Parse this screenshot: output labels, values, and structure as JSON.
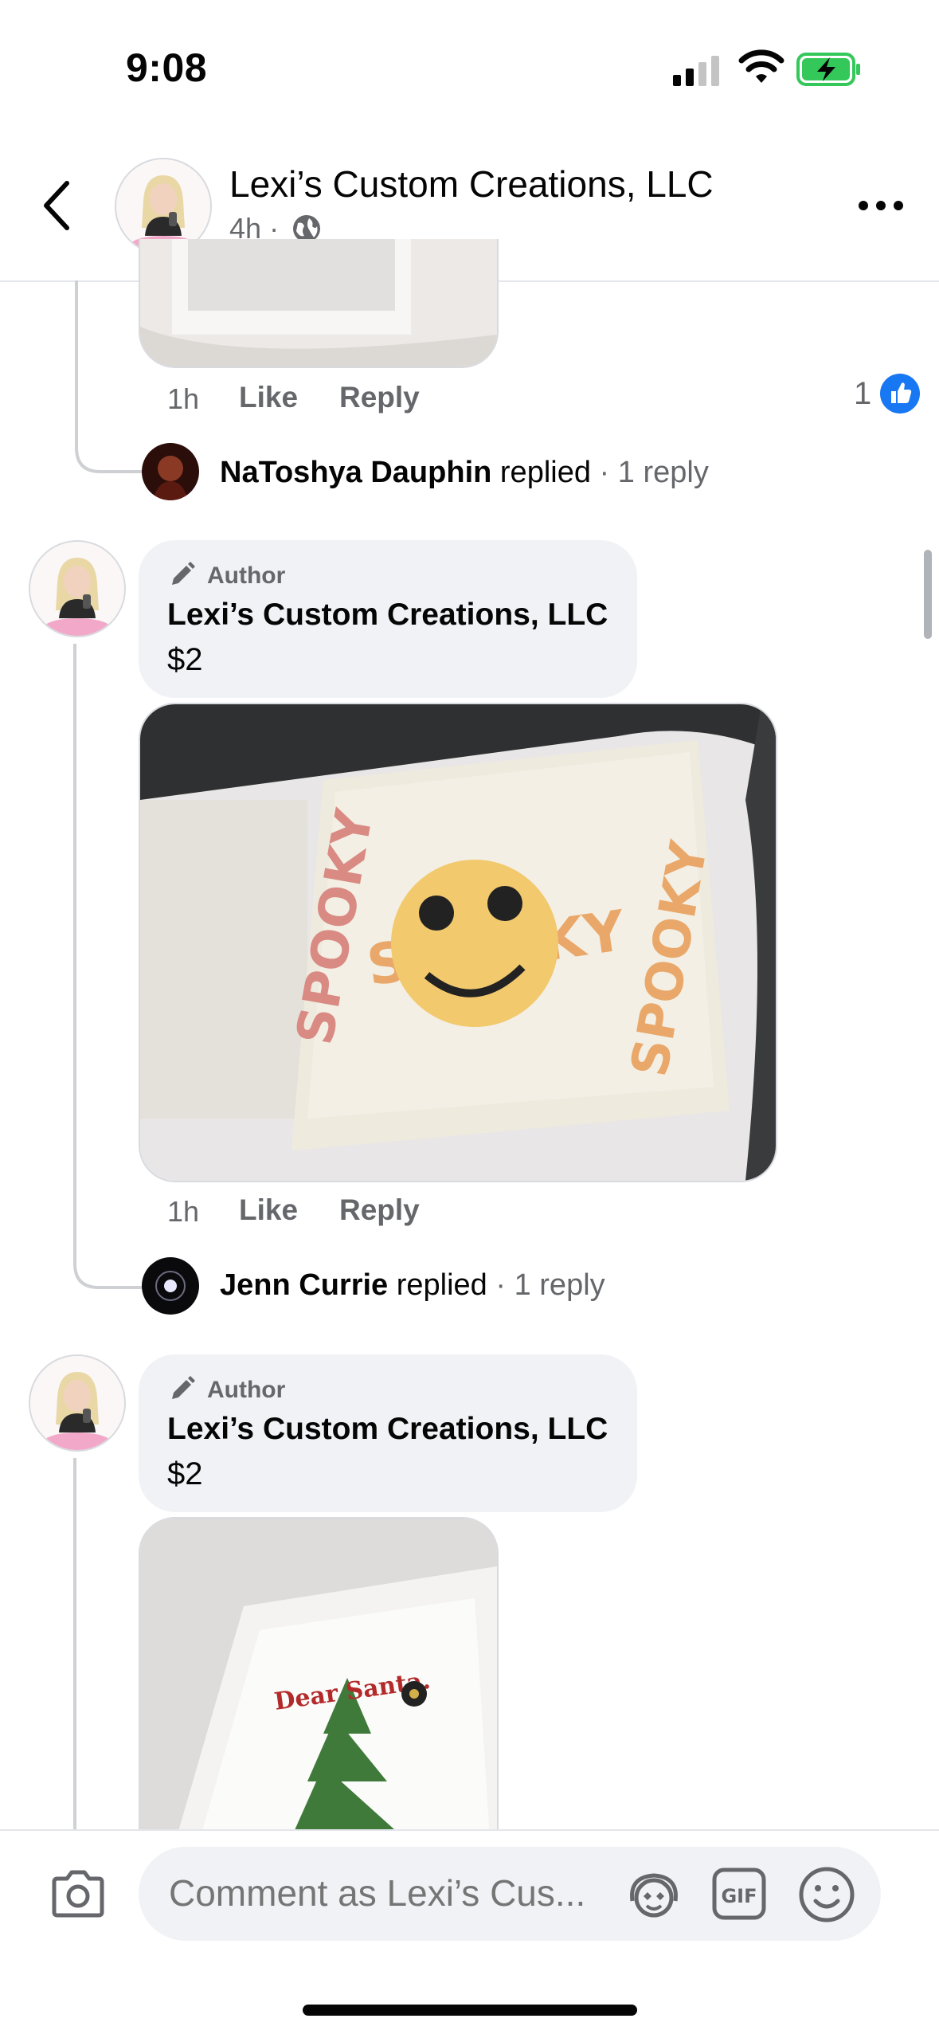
{
  "status_bar": {
    "time": "9:08"
  },
  "header": {
    "title": "Lexi’s Custom Creations, LLC",
    "time": "4h",
    "separator": "·",
    "privacy_icon": "globe-icon"
  },
  "thread1": {
    "meta": {
      "time": "1h",
      "like": "Like",
      "reply": "Reply"
    },
    "reaction_count": "1",
    "reply_summary": {
      "name": "NaToshya Dauphin",
      "action": "replied",
      "count": "· 1 reply"
    }
  },
  "comment2": {
    "badge": "Author",
    "name": "Lexi’s Custom Creations, LLC",
    "text": "$2",
    "meta": {
      "time": "1h",
      "like": "Like",
      "reply": "Reply"
    },
    "reply_summary": {
      "name": "Jenn Currie",
      "action": "replied",
      "count": "· 1 reply"
    }
  },
  "comment3": {
    "badge": "Author",
    "name": "Lexi’s Custom Creations, LLC",
    "text": "$2"
  },
  "composer": {
    "placeholder": "Comment as Lexi’s Cus..."
  },
  "colors": {
    "like_blue": "#1877f2",
    "battery_green": "#34c759",
    "bubble_bg": "#f0f2f5",
    "secondary_text": "#65676b"
  }
}
